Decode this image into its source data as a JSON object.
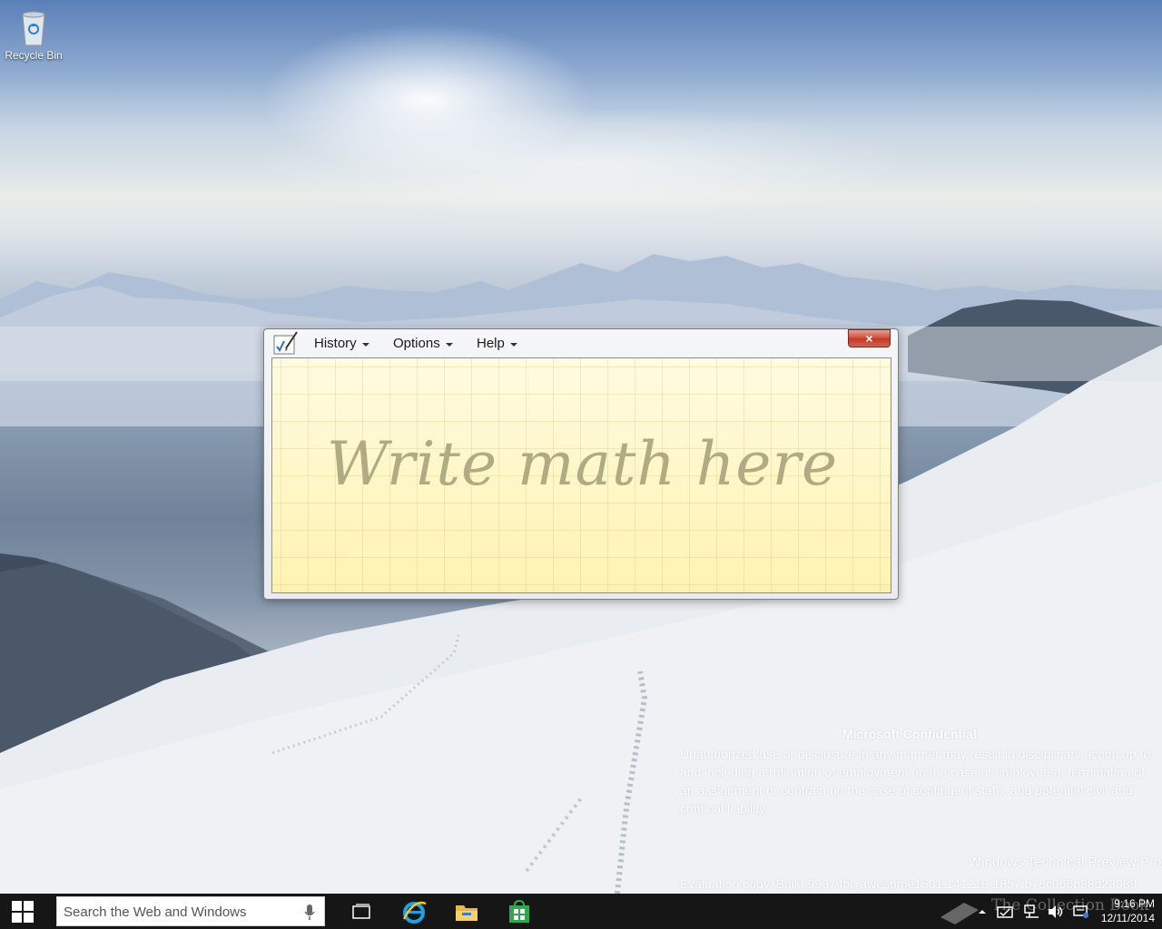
{
  "desktop": {
    "icons": [
      {
        "label": "Recycle Bin",
        "icon": "recycle-bin-icon"
      }
    ]
  },
  "window": {
    "app_icon": "math-input-panel-icon",
    "menus": [
      {
        "label": "History"
      },
      {
        "label": "Options"
      },
      {
        "label": "Help"
      }
    ],
    "close_label": "×",
    "canvas_hint": "Write math here"
  },
  "watermark": {
    "title": "Microsoft Confidential",
    "body": "Unauthorized use or disclosure in any manner may result in disciplinary action up to and including termination of employment (in the case of employees), termination of an assignment or contract (in the case of contingent staff), and potential civil and criminal liability.",
    "edition": "Windows Technical Preview Pro",
    "build": "Evaluation copy. Build 9907.fbl_awesome1501.141210-1857.b78c066b98d23089"
  },
  "taskbar": {
    "search_placeholder": "Search the Web and Windows",
    "apps": [
      {
        "name": "task-view",
        "icon": "task-view-icon"
      },
      {
        "name": "internet-explorer",
        "icon": "internet-explorer-icon"
      },
      {
        "name": "file-explorer",
        "icon": "file-explorer-icon"
      },
      {
        "name": "store",
        "icon": "store-icon"
      }
    ],
    "overlay_text": "The Collection Book",
    "clock_time": "9:16 PM",
    "clock_date": "12/11/2014"
  },
  "colors": {
    "taskbar": "#101010",
    "canvas": "#fff8c6",
    "close_button": "#c94a36"
  }
}
